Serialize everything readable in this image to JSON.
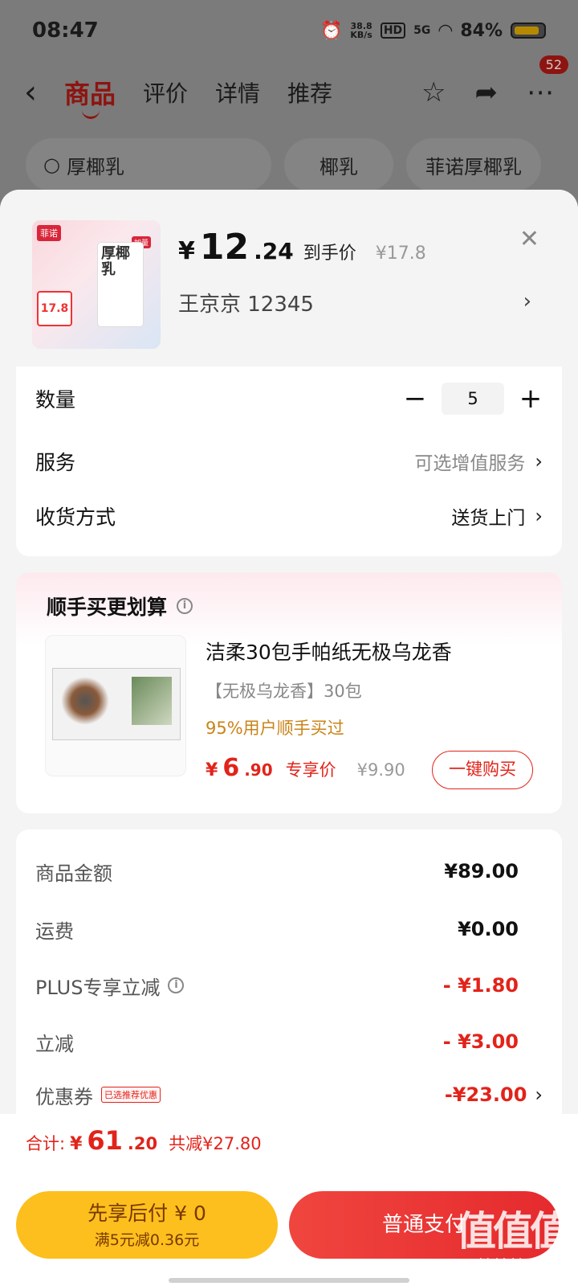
{
  "status_bar": {
    "time": "08:47",
    "net_speed_top": "38.8",
    "net_speed_unit": "KB/s",
    "hd": "HD",
    "signal": "5G",
    "battery": "84%"
  },
  "top_nav": {
    "tabs": [
      "商品",
      "评价",
      "详情",
      "推荐"
    ],
    "badge": "52"
  },
  "search": {
    "query": "厚椰乳",
    "chips": [
      "椰乳",
      "菲诺厚椰乳"
    ]
  },
  "product": {
    "currency": "¥",
    "price_int": "12",
    "price_dec": ".24",
    "price_label": "到手价",
    "original_price": "¥17.8",
    "shop_line": "王京京  12345",
    "image_brand": "菲诺",
    "image_title": "厚椰乳",
    "image_price": "17.8",
    "image_tag": "加量"
  },
  "options": {
    "quantity_label": "数量",
    "quantity_value": "5",
    "service_label": "服务",
    "service_value": "可选增值服务",
    "delivery_label": "收货方式",
    "delivery_value": "送货上门"
  },
  "recommend": {
    "title": "顺手买更划算",
    "item_title": "洁柔30包手帕纸无极乌龙香",
    "item_sub": "【无极乌龙香】30包",
    "item_note": "95%用户顺手买过",
    "price_yen": "¥",
    "price_int": "6",
    "price_dec": ".90",
    "price_label": "专享价",
    "original_price": "¥9.90",
    "buy_label": "一键购买"
  },
  "fees": {
    "items_label": "商品金额",
    "items_value": "¥89.00",
    "shipping_label": "运费",
    "shipping_value": "¥0.00",
    "plus_label": "PLUS专享立减",
    "plus_value": "- ¥1.80",
    "discount_label": "立减",
    "discount_value": "- ¥3.00",
    "coupon_label": "优惠券",
    "coupon_tag": "已选推荐优惠",
    "coupon_value": "-¥23.00"
  },
  "totals": {
    "label": "合计:",
    "yen": "¥",
    "amount_int": "61",
    "amount_dec": ".20",
    "saved": "共减¥27.80"
  },
  "buttons": {
    "pay_later_l1": "先享后付 ¥ 0",
    "pay_later_l2": "满5元减0.36元",
    "pay_normal": "普通支付"
  },
  "watermark": {
    "cn": "值值值",
    "url": "zhizhizhi.com"
  },
  "colors": {
    "accent_red": "#e2231a",
    "pay_later_yellow": "#fcbf1e"
  }
}
